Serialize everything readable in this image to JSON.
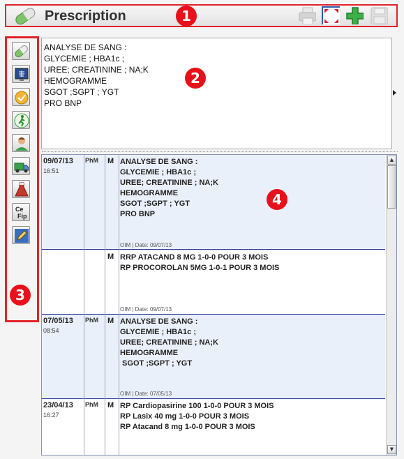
{
  "header": {
    "title": "Prescription"
  },
  "markers": [
    "1",
    "2",
    "3",
    "4"
  ],
  "editor": {
    "lines": [
      "ANALYSE DE SANG :",
      "",
      "GLYCEMIE ; HBA1c ;",
      "UREE; CREATININE ; NA;K",
      "HEMOGRAMME",
      "SGOT ;SGPT ; YGT",
      "PRO BNP"
    ]
  },
  "history": [
    {
      "date": "09/07/13",
      "time": "16:51",
      "by": "PhM",
      "flag": "M",
      "lines": [
        "ANALYSE DE SANG :",
        "",
        "GLYCEMIE ; HBA1c ;",
        "UREE; CREATININE ; NA;K",
        "HEMOGRAMME",
        "SGOT ;SGPT ; YGT",
        "PRO BNP"
      ],
      "footer": "OIM | Date: 09/07/13"
    },
    {
      "date": "",
      "time": "",
      "by": "",
      "flag": "M",
      "lines": [
        "RRP ATACAND 8 MG 1-0-0 POUR 3 MOIS",
        "",
        "",
        "RP PROCOROLAN 5MG 1-0-1 POUR 3 MOIS"
      ],
      "footer": "OIM | Date: 09/07/13"
    },
    {
      "date": "07/05/13",
      "time": "08:54",
      "by": "PhM",
      "flag": "M",
      "lines": [
        "ANALYSE DE SANG :",
        "",
        "GLYCEMIE ; HBA1c ;",
        "UREE; CREATININE ; NA;K",
        "HEMOGRAMME",
        " SGOT ;SGPT ; YGT"
      ],
      "footer": "OIM | Date: 07/05/13"
    },
    {
      "date": "23/04/13",
      "time": "16:27",
      "by": "PhM",
      "flag": "M",
      "lines": [
        "RP Cardiopasirine 100 1-0-0 POUR 3 MOIS",
        "",
        "RP Lasix 40 mg 1-0-0 POUR 3 MOIS",
        "",
        "RP Atacand 8 mg 1-0-0 POUR 3 MOIS"
      ],
      "footer": ""
    }
  ],
  "sidebar_icons": [
    "capsule-icon",
    "xray-icon",
    "certificate-icon",
    "runner-icon",
    "doctor-icon",
    "ambulance-icon",
    "flask-icon",
    "cefip-icon",
    "pen-icon"
  ],
  "sidebar_cefip_text": [
    "Ce",
    "Fip"
  ],
  "toolbar_icons": [
    "printer-icon",
    "fullscreen-icon",
    "add-icon",
    "save-icon"
  ],
  "colors": {
    "accent": "#e2232a",
    "row_alt": "#eaf0fa",
    "row_border": "#2a3aa0"
  }
}
